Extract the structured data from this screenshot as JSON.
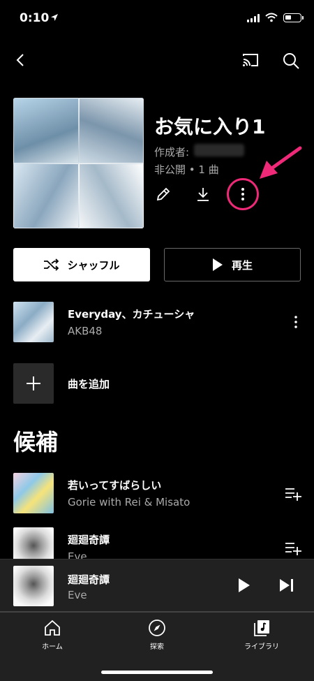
{
  "status_bar": {
    "time": "0:10"
  },
  "playlist": {
    "title": "お気に入り1",
    "author_label": "作成者:",
    "meta": "非公開 • 1 曲"
  },
  "buttons": {
    "shuffle": "シャッフル",
    "play": "再生"
  },
  "tracks": [
    {
      "title": "Everyday、カチューシャ",
      "artist": "AKB48"
    }
  ],
  "add_song_label": "曲を追加",
  "suggestions": {
    "title": "候補",
    "items": [
      {
        "title": "若いってすばらしい",
        "artist": "Gorie with Rei & Misato"
      },
      {
        "title": "廻廻奇譚",
        "artist": "Eve"
      }
    ]
  },
  "now_playing": {
    "title": "廻廻奇譚",
    "artist": "Eve"
  },
  "nav": [
    {
      "label": "ホーム",
      "icon": "home-icon"
    },
    {
      "label": "探索",
      "icon": "compass-icon"
    },
    {
      "label": "ライブラリ",
      "icon": "library-icon"
    }
  ],
  "colors": {
    "background": "#000000",
    "accent_annotation": "#ee2a78",
    "surface": "#212121"
  }
}
